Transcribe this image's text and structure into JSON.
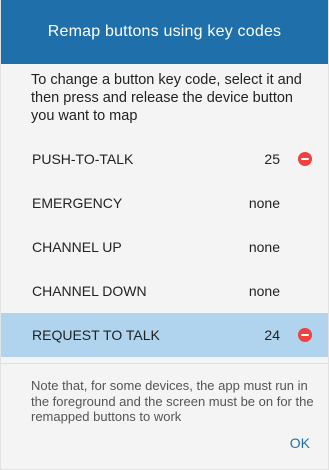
{
  "dialog": {
    "title": "Remap buttons using key codes",
    "instructions": "To change a button key code, select it and then press and release the device button you want to map",
    "rows": [
      {
        "name": "PUSH-TO-TALK",
        "code": "25",
        "removable": true,
        "selected": false
      },
      {
        "name": "EMERGENCY",
        "code": "none",
        "removable": false,
        "selected": false
      },
      {
        "name": "CHANNEL UP",
        "code": "none",
        "removable": false,
        "selected": false
      },
      {
        "name": "CHANNEL DOWN",
        "code": "none",
        "removable": false,
        "selected": false
      },
      {
        "name": "REQUEST TO TALK",
        "code": "24",
        "removable": true,
        "selected": true
      }
    ],
    "note": "Note that, for some devices, the app must run in the foreground and the screen must be on for the remapped buttons to work",
    "ok_label": "OK"
  },
  "colors": {
    "header": "#1f70aa",
    "selected_row": "#b0d4ee",
    "remove_icon": "#f04040",
    "accent_text": "#1f70aa"
  },
  "icons": {
    "remove": "minus-circle-icon"
  }
}
